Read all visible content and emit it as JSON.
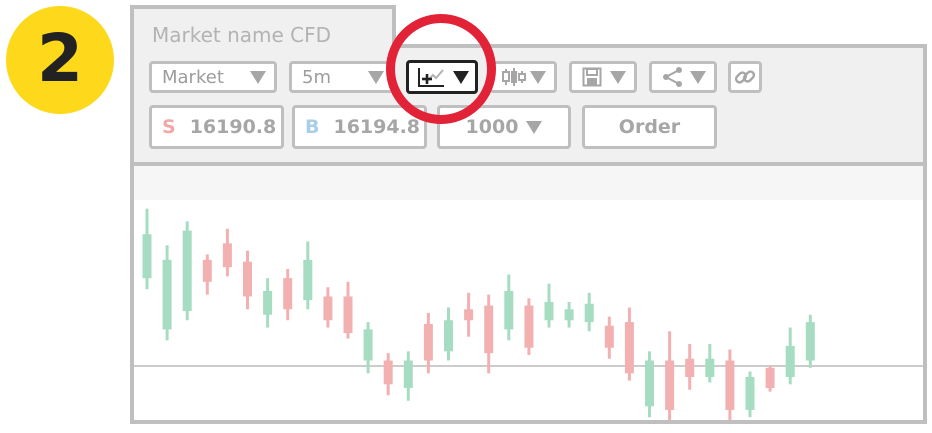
{
  "step_badge": "2",
  "market_name": "Market name CFD",
  "toolbar": {
    "market_dropdown": "Market",
    "interval_dropdown": "5m",
    "indicator_icon": "add-indicator-icon",
    "chart_type_icon": "candlestick-icon",
    "save_icon": "save-icon",
    "share_icon": "share-icon",
    "link_icon": "link-icon"
  },
  "trade": {
    "sell_label": "S",
    "sell_price": "16190.8",
    "buy_label": "B",
    "buy_price": "16194.8",
    "quantity": "1000",
    "order_button": "Order"
  },
  "colors": {
    "badge": "#fed81b",
    "highlight_ring": "#e22236",
    "up_candle": "#a6dcc2",
    "down_candle": "#f2b0b0",
    "sell": "#f2a7a7",
    "buy": "#a9cfe8"
  },
  "candles": [
    {
      "o": 0.48,
      "c": 0.72,
      "h": 0.86,
      "l": 0.42
    },
    {
      "o": 0.2,
      "c": 0.58,
      "h": 0.66,
      "l": 0.14
    },
    {
      "o": 0.3,
      "c": 0.74,
      "h": 0.79,
      "l": 0.25
    },
    {
      "o": 0.58,
      "c": 0.46,
      "h": 0.61,
      "l": 0.39
    },
    {
      "o": 0.67,
      "c": 0.54,
      "h": 0.75,
      "l": 0.49
    },
    {
      "o": 0.57,
      "c": 0.38,
      "h": 0.63,
      "l": 0.31
    },
    {
      "o": 0.28,
      "c": 0.41,
      "h": 0.48,
      "l": 0.21
    },
    {
      "o": 0.48,
      "c": 0.31,
      "h": 0.53,
      "l": 0.25
    },
    {
      "o": 0.36,
      "c": 0.58,
      "h": 0.68,
      "l": 0.31
    },
    {
      "o": 0.38,
      "c": 0.25,
      "h": 0.43,
      "l": 0.21
    },
    {
      "o": 0.38,
      "c": 0.18,
      "h": 0.46,
      "l": 0.15
    },
    {
      "o": 0.03,
      "c": 0.2,
      "h": 0.24,
      "l": -0.04
    },
    {
      "o": 0.03,
      "c": -0.1,
      "h": 0.07,
      "l": -0.16
    },
    {
      "o": -0.12,
      "c": 0.03,
      "h": 0.08,
      "l": -0.19
    },
    {
      "o": 0.23,
      "c": 0.03,
      "h": 0.29,
      "l": -0.04
    },
    {
      "o": 0.08,
      "c": 0.25,
      "h": 0.32,
      "l": 0.03
    },
    {
      "o": 0.31,
      "c": 0.25,
      "h": 0.4,
      "l": 0.16
    },
    {
      "o": 0.33,
      "c": 0.07,
      "h": 0.39,
      "l": -0.04
    },
    {
      "o": 0.2,
      "c": 0.41,
      "h": 0.5,
      "l": 0.14
    },
    {
      "o": 0.33,
      "c": 0.1,
      "h": 0.37,
      "l": 0.06
    },
    {
      "o": 0.25,
      "c": 0.35,
      "h": 0.45,
      "l": 0.21
    },
    {
      "o": 0.25,
      "c": 0.31,
      "h": 0.35,
      "l": 0.21
    },
    {
      "o": 0.24,
      "c": 0.34,
      "h": 0.4,
      "l": 0.19
    },
    {
      "o": 0.22,
      "c": 0.1,
      "h": 0.27,
      "l": 0.04
    },
    {
      "o": 0.24,
      "c": -0.04,
      "h": 0.32,
      "l": -0.08
    },
    {
      "o": -0.22,
      "c": 0.03,
      "h": 0.08,
      "l": -0.28
    },
    {
      "o": 0.03,
      "c": -0.24,
      "h": 0.19,
      "l": -0.35
    },
    {
      "o": 0.04,
      "c": -0.06,
      "h": 0.12,
      "l": -0.13
    },
    {
      "o": -0.06,
      "c": 0.04,
      "h": 0.12,
      "l": -0.09
    },
    {
      "o": 0.03,
      "c": -0.24,
      "h": 0.09,
      "l": -0.34
    },
    {
      "o": -0.24,
      "c": -0.06,
      "h": -0.03,
      "l": -0.28
    },
    {
      "o": -0.01,
      "c": -0.12,
      "h": 0.0,
      "l": -0.14
    },
    {
      "o": -0.06,
      "c": 0.11,
      "h": 0.21,
      "l": -0.1
    },
    {
      "o": 0.03,
      "c": 0.24,
      "h": 0.28,
      "l": -0.01
    }
  ]
}
